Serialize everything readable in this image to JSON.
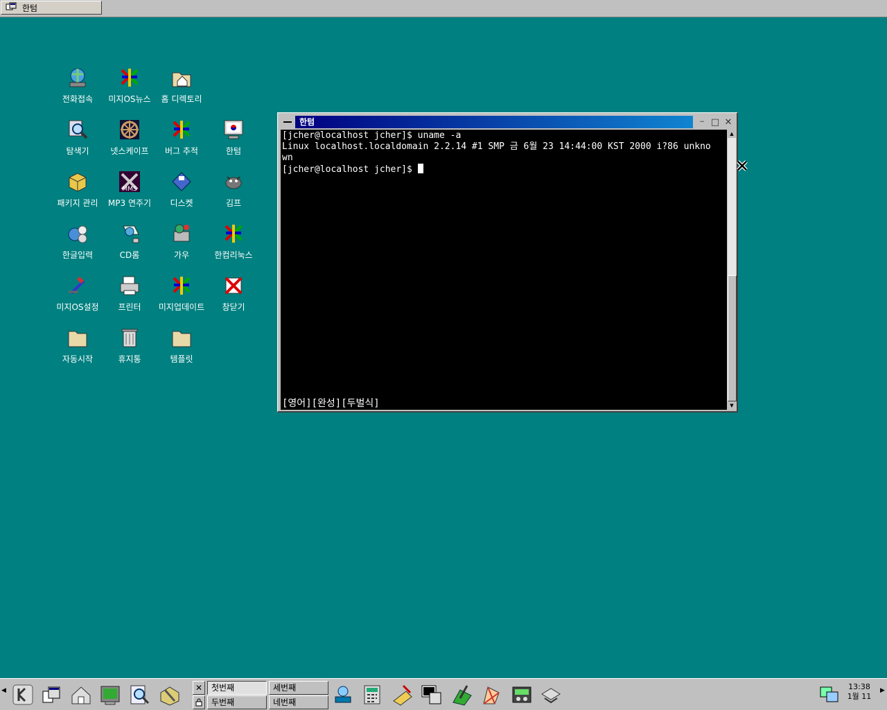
{
  "top_taskbar": {
    "task_label": "한텀",
    "task_icon": "terminal-window-icon"
  },
  "desktop_icons": [
    {
      "label": "전화접속",
      "icon": "dialup-globe-icon"
    },
    {
      "label": "미지OS뉴스",
      "icon": "mizi-logo-icon"
    },
    {
      "label": "홈 디렉토리",
      "icon": "home-folder-icon"
    },
    {
      "label": "탐색기",
      "icon": "explorer-magnifier-icon"
    },
    {
      "label": "넷스케이프",
      "icon": "netscape-wheel-icon"
    },
    {
      "label": "버그 추적",
      "icon": "mizi-logo-icon"
    },
    {
      "label": "한텀",
      "icon": "terminal-monitor-icon"
    },
    {
      "label": "패키지 관리",
      "icon": "package-box-icon"
    },
    {
      "label": "MP3 연주기",
      "icon": "mp3-player-icon"
    },
    {
      "label": "디스켓",
      "icon": "floppy-disk-icon"
    },
    {
      "label": "김프",
      "icon": "gimp-icon"
    },
    {
      "label": "한글입력",
      "icon": "hangul-input-icon"
    },
    {
      "label": "CD롬",
      "icon": "cdrom-icon"
    },
    {
      "label": "가우",
      "icon": "gau-icon"
    },
    {
      "label": "한컴리눅스",
      "icon": "mizi-logo-icon"
    },
    {
      "label": "미지OS설정",
      "icon": "settings-icon"
    },
    {
      "label": "프린터",
      "icon": "printer-icon"
    },
    {
      "label": "미지업데이트",
      "icon": "mizi-logo-icon"
    },
    {
      "label": "창닫기",
      "icon": "close-window-icon"
    },
    {
      "label": "자동시작",
      "icon": "autostart-folder-icon"
    },
    {
      "label": "휴지통",
      "icon": "trash-icon"
    },
    {
      "label": "템플릿",
      "icon": "templates-folder-icon"
    }
  ],
  "terminal": {
    "title": "한텀",
    "lines": [
      "[jcher@localhost jcher]$ uname -a",
      "Linux localhost.localdomain 2.2.14 #1 SMP 금 6월 23 14:44:00 KST 2000 i?86 unkno",
      "wn",
      "[jcher@localhost jcher]$ "
    ],
    "status": "[영어][완성][두벌식]",
    "controls": {
      "minimize": "−",
      "maximize": "□",
      "close": "✕"
    }
  },
  "bottom_panel": {
    "desktops": [
      "첫번째",
      "세번째",
      "두번째",
      "네번째"
    ],
    "active_desktop": "첫번째",
    "launchers": [
      "kde-start-icon",
      "window-list-icon",
      "home-icon",
      "terminal-icon",
      "search-icon",
      "config-tools-icon",
      "package-icon",
      "calculator-icon",
      "paint-icon",
      "terminal-window-icon",
      "editor-icon",
      "office-icon",
      "cd-player-icon",
      "network-icon"
    ],
    "tray_icon": "network-tray-icon",
    "clock_time": "13:38",
    "clock_date": "1월 11"
  },
  "colors": {
    "desktop": "#008080",
    "titlebar_start": "#000080",
    "titlebar_end": "#1084d0",
    "terminal_bg": "#000000",
    "panel": "#c0c0c0"
  }
}
